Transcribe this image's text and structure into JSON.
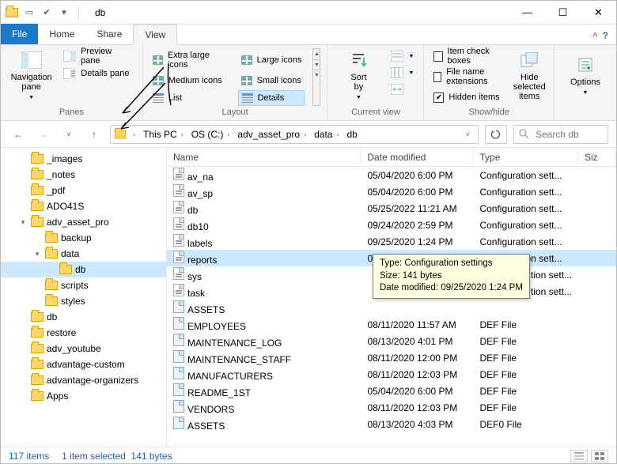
{
  "window": {
    "title": "db"
  },
  "tabs": {
    "file": "File",
    "home": "Home",
    "share": "Share",
    "view": "View"
  },
  "ribbon": {
    "panes_group": "Panes",
    "layout_group": "Layout",
    "currentview_group": "Current view",
    "showhide_group": "Show/hide",
    "nav_pane": "Navigation\npane",
    "preview_pane": "Preview pane",
    "details_pane": "Details pane",
    "xl_icons": "Extra large icons",
    "lg_icons": "Large icons",
    "md_icons": "Medium icons",
    "sm_icons": "Small icons",
    "list": "List",
    "details": "Details",
    "sort_by": "Sort\nby",
    "item_checkboxes": "Item check boxes",
    "file_ext": "File name extensions",
    "hidden_items": "Hidden items",
    "hide_selected": "Hide selected\nitems",
    "options": "Options"
  },
  "breadcrumb": [
    "This PC",
    "OS (C:)",
    "adv_asset_pro",
    "data",
    "db"
  ],
  "search_placeholder": "Search db",
  "tree": [
    {
      "lvl": 0,
      "label": "_images"
    },
    {
      "lvl": 0,
      "label": "_notes"
    },
    {
      "lvl": 0,
      "label": "_pdf"
    },
    {
      "lvl": 0,
      "label": "ADO41S"
    },
    {
      "lvl": 0,
      "label": "adv_asset_pro",
      "exp": "▾"
    },
    {
      "lvl": 1,
      "label": "backup"
    },
    {
      "lvl": 1,
      "label": "data",
      "exp": "▾"
    },
    {
      "lvl": 2,
      "label": "db",
      "selected": true
    },
    {
      "lvl": 1,
      "label": "scripts"
    },
    {
      "lvl": 1,
      "label": "styles"
    },
    {
      "lvl": 0,
      "label": "db"
    },
    {
      "lvl": 0,
      "label": "restore"
    },
    {
      "lvl": 0,
      "label": "adv_youtube"
    },
    {
      "lvl": 0,
      "label": "advantage-custom"
    },
    {
      "lvl": 0,
      "label": "advantage-organizers"
    },
    {
      "lvl": 0,
      "label": "Apps"
    }
  ],
  "columns": {
    "name": "Name",
    "date": "Date modified",
    "type": "Type",
    "size": "Siz"
  },
  "files": [
    {
      "name": "av_na",
      "date": "05/04/2020 6:00 PM",
      "type": "Configuration sett...",
      "kind": "cfg"
    },
    {
      "name": "av_sp",
      "date": "05/04/2020 6:00 PM",
      "type": "Configuration sett...",
      "kind": "cfg"
    },
    {
      "name": "db",
      "date": "05/25/2022 11:21 AM",
      "type": "Configuration sett...",
      "kind": "cfg"
    },
    {
      "name": "db10",
      "date": "09/24/2020 2:59 PM",
      "type": "Configuration sett...",
      "kind": "cfg"
    },
    {
      "name": "labels",
      "date": "09/25/2020 1:24 PM",
      "type": "Configuration sett...",
      "kind": "cfg"
    },
    {
      "name": "reports",
      "date": "09/25/2020 1:24 PM",
      "type": "Configuration sett...",
      "kind": "cfg",
      "selected": true
    },
    {
      "name": "sys",
      "date": "",
      "type": "",
      "kind": "cfg",
      "type_suffix": "tion sett..."
    },
    {
      "name": "task",
      "date": "",
      "type": "",
      "kind": "cfg",
      "type_suffix": "tion sett..."
    },
    {
      "name": "ASSETS",
      "date": "",
      "type": "",
      "kind": "def"
    },
    {
      "name": "EMPLOYEES",
      "date": "08/11/2020 11:57 AM",
      "type": "DEF File",
      "kind": "def"
    },
    {
      "name": "MAINTENANCE_LOG",
      "date": "08/13/2020 4:01 PM",
      "type": "DEF File",
      "kind": "def"
    },
    {
      "name": "MAINTENANCE_STAFF",
      "date": "08/11/2020 12:00 PM",
      "type": "DEF File",
      "kind": "def"
    },
    {
      "name": "MANUFACTURERS",
      "date": "08/11/2020 12:03 PM",
      "type": "DEF File",
      "kind": "def"
    },
    {
      "name": "README_1ST",
      "date": "05/04/2020 6:00 PM",
      "type": "DEF File",
      "kind": "def"
    },
    {
      "name": "VENDORS",
      "date": "08/11/2020 12:03 PM",
      "type": "DEF File",
      "kind": "def"
    },
    {
      "name": "ASSETS",
      "date": "08/13/2020 4:03 PM",
      "type": "DEF0 File",
      "kind": "def"
    }
  ],
  "tooltip": {
    "l1": "Type: Configuration settings",
    "l2": "Size: 141 bytes",
    "l3": "Date modified: 09/25/2020 1:24 PM"
  },
  "status": {
    "count": "117 items",
    "selected": "1 item selected",
    "size": "141 bytes"
  }
}
